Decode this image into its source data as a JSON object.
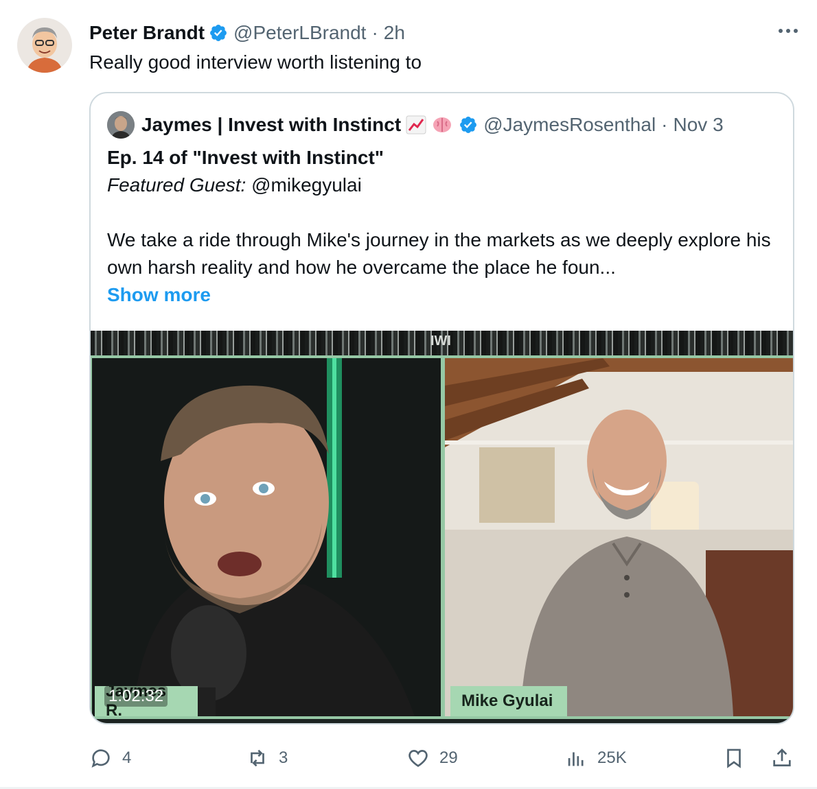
{
  "tweet": {
    "author_name": "Peter Brandt",
    "author_handle": "@PeterLBrandt",
    "separator": "·",
    "time": "2h",
    "text": "Really good interview worth listening to"
  },
  "quote": {
    "author_name": "Jaymes | Invest with Instinct",
    "author_handle": "@JaymesRosenthal",
    "separator": "·",
    "date": "Nov 3",
    "title": "Ep. 14 of \"Invest with Instinct\"",
    "guest_label": "Featured Guest:",
    "guest_handle": " @mikegyulai",
    "body": "We take a ride through Mike's journey in the markets as we deeply explore his own harsh reality and how he overcame the place he foun...",
    "show_more": "Show more",
    "media": {
      "banner_text": "IWI",
      "left_name": "Jaymes R.",
      "right_name": "Mike Gyulai",
      "duration": "1:02:32"
    }
  },
  "actions": {
    "replies": "4",
    "reposts": "3",
    "likes": "29",
    "views": "25K"
  },
  "colors": {
    "accent": "#1d9bf0",
    "muted": "#536471",
    "name_tag": "#a6d7b2"
  }
}
